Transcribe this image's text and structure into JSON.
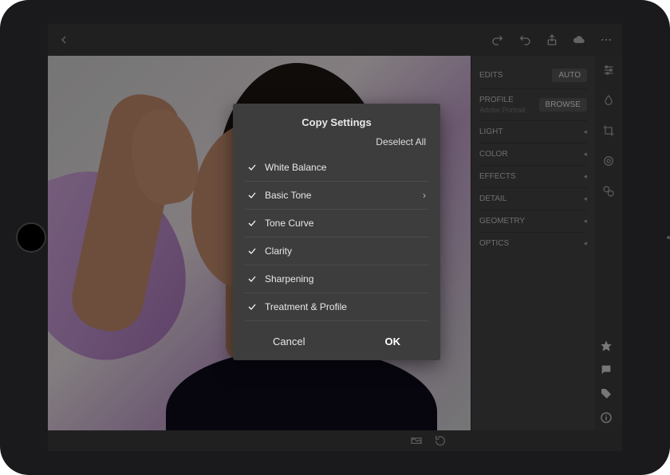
{
  "topbar": {
    "icons": {
      "back": "back-icon",
      "redo": "redo-icon",
      "undo": "undo-icon",
      "share": "share-icon",
      "cloud": "cloud-icon",
      "more": "more-icon"
    }
  },
  "panel": {
    "edits_label": "EDITS",
    "auto_label": "AUTO",
    "profile_label": "PROFILE",
    "profile_value": "Adobe Portrait",
    "browse_label": "BROWSE",
    "sections": [
      {
        "label": "LIGHT"
      },
      {
        "label": "COLOR"
      },
      {
        "label": "EFFECTS"
      },
      {
        "label": "DETAIL"
      },
      {
        "label": "GEOMETRY"
      },
      {
        "label": "OPTICS"
      }
    ]
  },
  "modal": {
    "title": "Copy Settings",
    "deselect": "Deselect All",
    "items": [
      {
        "label": "White Balance",
        "checked": true,
        "expandable": false
      },
      {
        "label": "Basic Tone",
        "checked": true,
        "expandable": true
      },
      {
        "label": "Tone Curve",
        "checked": true,
        "expandable": false
      },
      {
        "label": "Clarity",
        "checked": true,
        "expandable": false
      },
      {
        "label": "Sharpening",
        "checked": true,
        "expandable": false
      },
      {
        "label": "Treatment & Profile",
        "checked": true,
        "expandable": false
      }
    ],
    "cancel": "Cancel",
    "ok": "OK"
  }
}
